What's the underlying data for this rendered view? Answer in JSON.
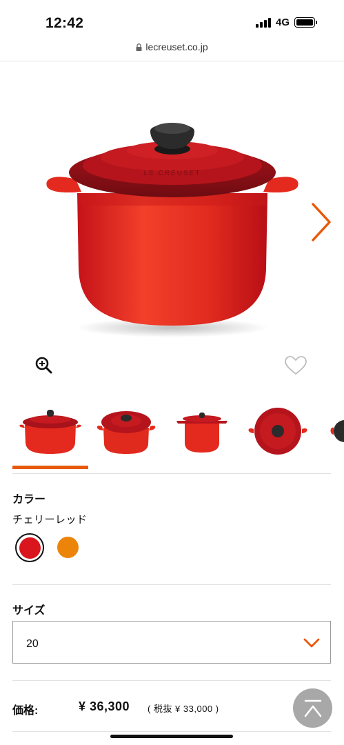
{
  "status_bar": {
    "time": "12:42",
    "network": "4G"
  },
  "browser": {
    "url": "lecreuset.co.jp"
  },
  "product": {
    "color_heading": "カラー",
    "color_name": "チェリーレッド",
    "swatches": [
      {
        "name": "cherry-red",
        "color": "#d9161d",
        "selected": true
      },
      {
        "name": "orange",
        "color": "#ec840a",
        "selected": false
      }
    ],
    "size_heading": "サイズ",
    "size_value": "20",
    "price_label": "価格:",
    "price_value": "¥ 36,300",
    "price_tax": "( 税抜 ¥ 33,000 )",
    "lid_brand_text": "LE CREUSET"
  },
  "colors": {
    "accent": "#e8590c",
    "product_red": "#d9161d"
  },
  "icons": [
    "lock-icon",
    "zoom-in-icon",
    "heart-icon",
    "chevron-right-icon",
    "chevron-down-icon",
    "scroll-to-top-icon"
  ]
}
